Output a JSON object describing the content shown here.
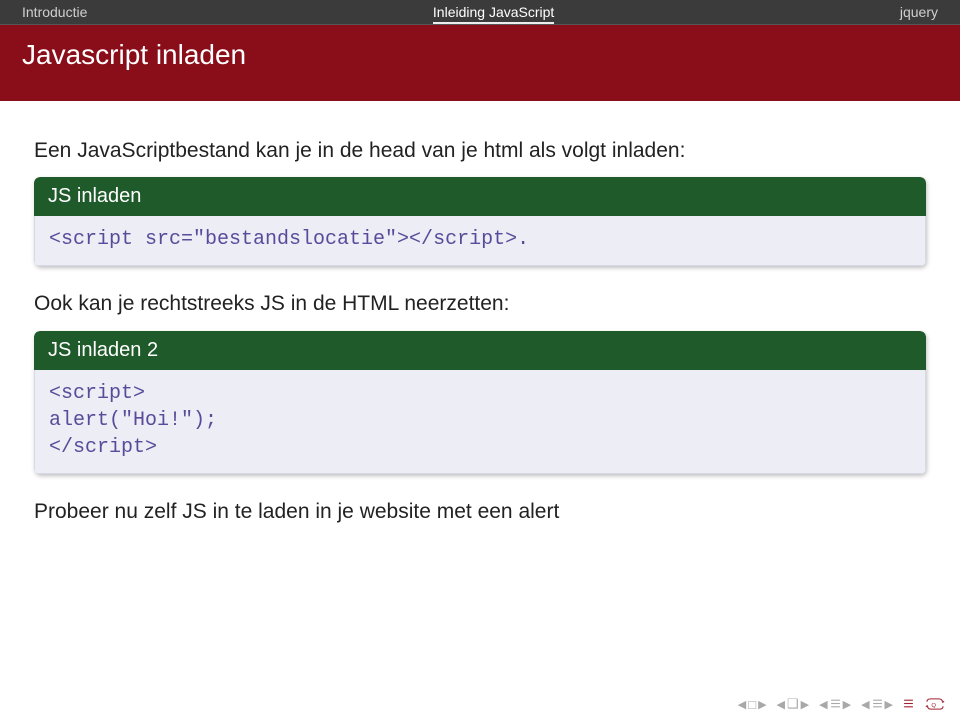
{
  "nav": {
    "left": "Introductie",
    "center": "Inleiding JavaScript",
    "right": "jquery"
  },
  "title": "Javascript inladen",
  "para1": "Een JavaScriptbestand kan je in de head van je html als volgt inladen:",
  "block1": {
    "title": "JS inladen",
    "code": "<script src=\"bestandslocatie\"></script>."
  },
  "para2": "Ook kan je rechtstreeks JS in de HTML neerzetten:",
  "block2": {
    "title": "JS inladen 2",
    "code": "<script>\nalert(\"Hoi!\");\n</script>"
  },
  "para3": "Probeer nu zelf JS in te laden in je website met een alert"
}
